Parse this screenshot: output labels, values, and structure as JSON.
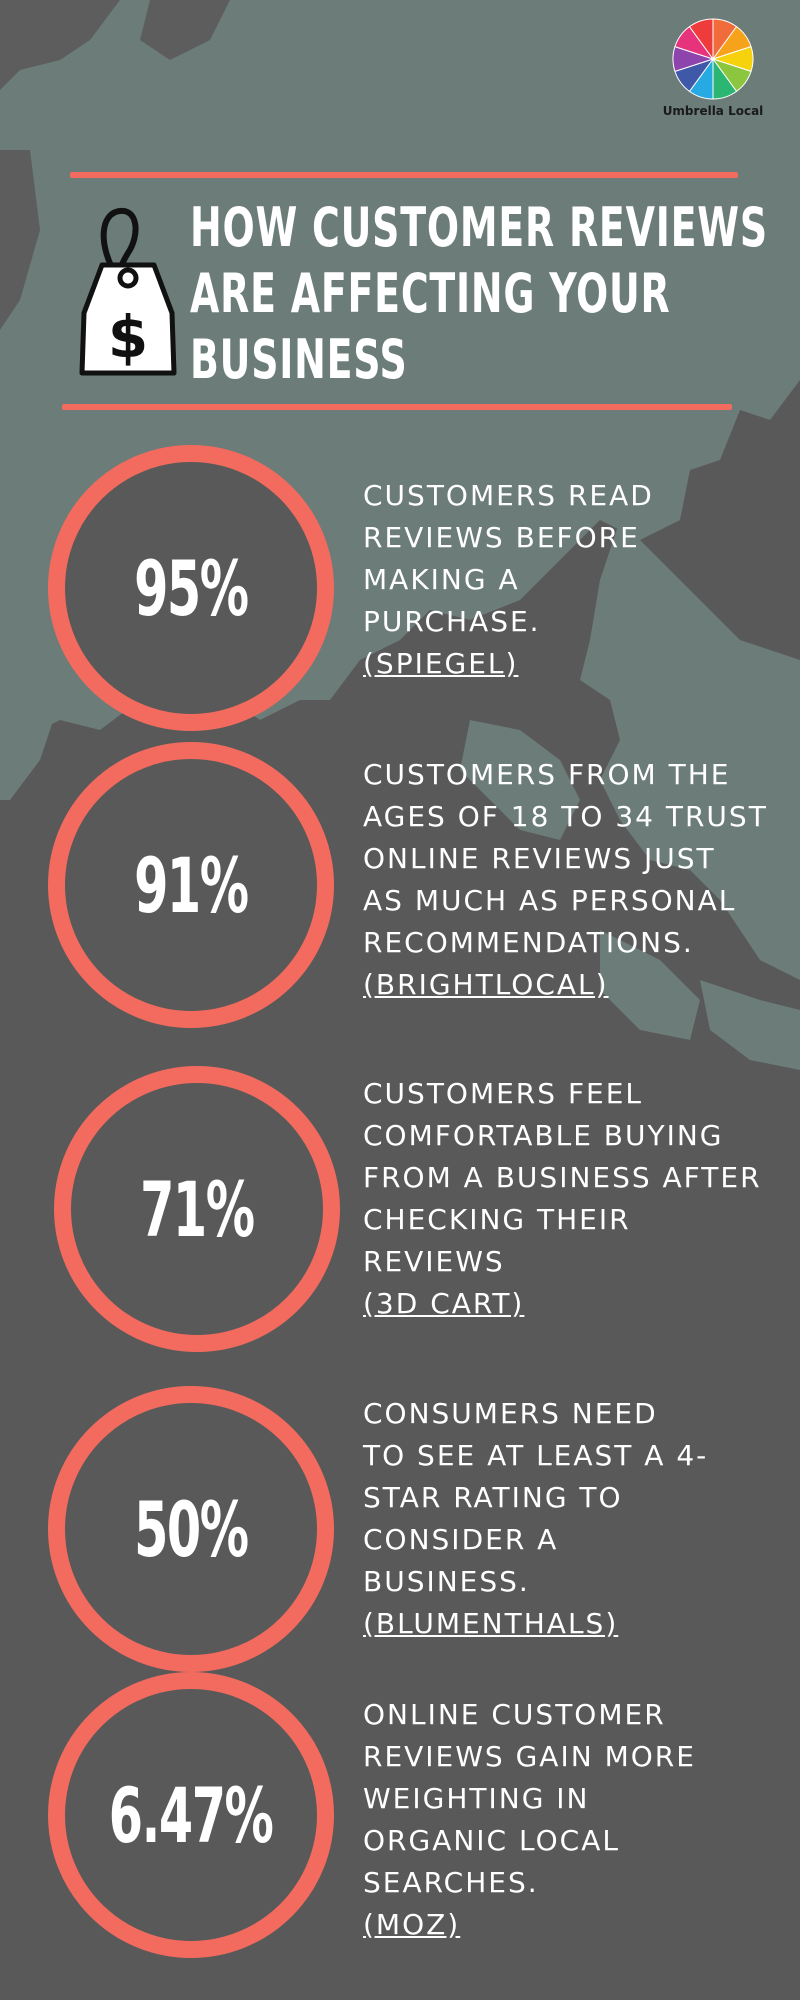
{
  "brand": {
    "name": "Umbrella Local"
  },
  "title_lines": [
    "HOW CUSTOMER REVIEWS",
    "ARE AFFECTING YOUR",
    "BUSINESS"
  ],
  "colors": {
    "background": "#595959",
    "map": "#6b7c79",
    "accent": "#f26b5e",
    "text": "#ffffff"
  },
  "icons": {
    "price_tag": "dollar-price-tag-icon",
    "logo": "umbrella-wheel-icon"
  },
  "stats": [
    {
      "value": "95%",
      "lines": [
        "CUSTOMERS READ",
        "REVIEWS BEFORE",
        "MAKING A",
        "PURCHASE."
      ],
      "source": "(SPIEGEL)"
    },
    {
      "value": "91%",
      "lines": [
        "CUSTOMERS FROM THE",
        "AGES OF 18 TO 34 TRUST",
        "ONLINE REVIEWS JUST",
        "AS MUCH AS PERSONAL",
        "RECOMMENDATIONS."
      ],
      "source": "(BRIGHTLOCAL)"
    },
    {
      "value": "71%",
      "lines": [
        "CUSTOMERS FEEL",
        "COMFORTABLE BUYING",
        "FROM A BUSINESS AFTER",
        "CHECKING THEIR",
        "REVIEWS"
      ],
      "source": "(3D CART)"
    },
    {
      "value": "50%",
      "lines": [
        "CONSUMERS NEED",
        "TO SEE AT LEAST A 4-",
        "STAR RATING TO",
        "CONSIDER A",
        "BUSINESS."
      ],
      "source": "(BLUMENTHALS)"
    },
    {
      "value": "6.47%",
      "lines": [
        "ONLINE CUSTOMER",
        "REVIEWS GAIN MORE",
        "WEIGHTING IN",
        "ORGANIC LOCAL",
        "SEARCHES."
      ],
      "source": "(MOZ)"
    }
  ]
}
